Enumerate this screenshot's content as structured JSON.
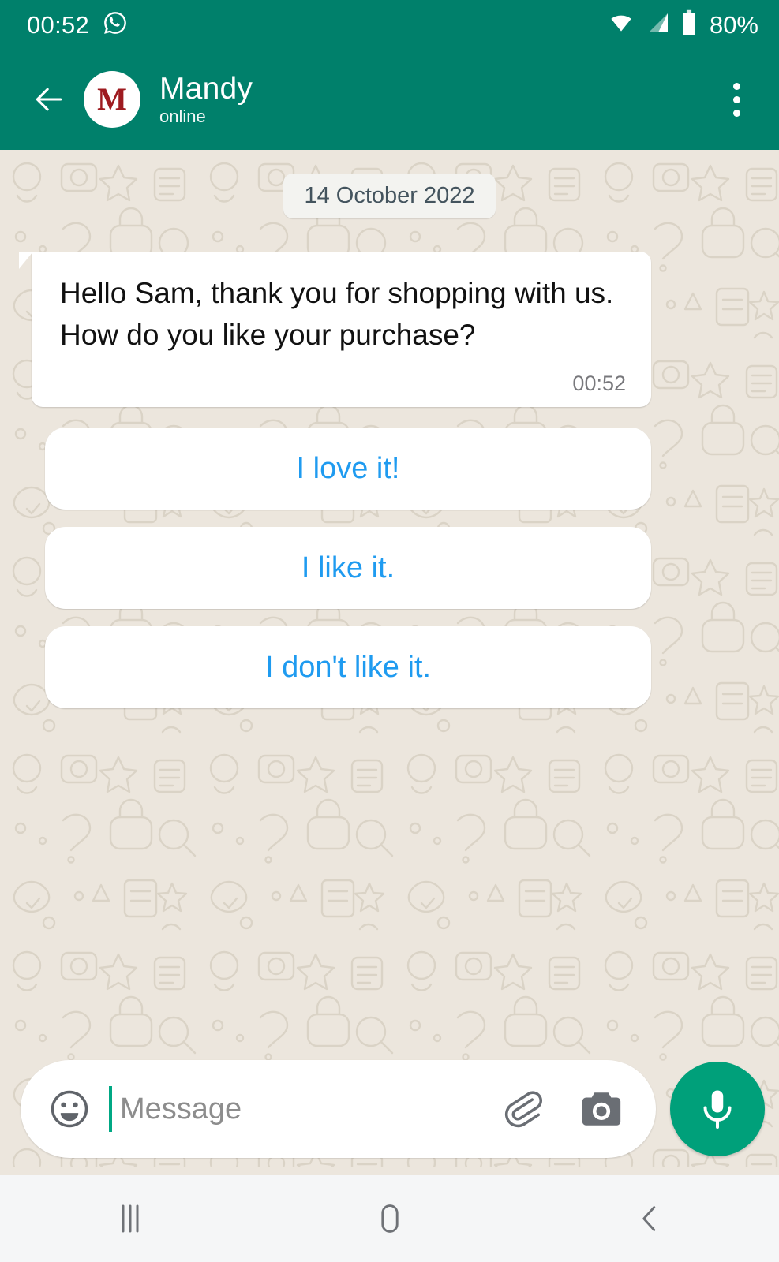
{
  "status_bar": {
    "time": "00:52",
    "notification_icon": "whatsapp-icon",
    "wifi_icon": "wifi-icon",
    "signal_icon": "cellular-signal-icon",
    "battery_icon": "battery-icon",
    "battery_percent": "80%"
  },
  "app_bar": {
    "back_icon": "back-arrow-icon",
    "avatar_letter": "M",
    "contact_name": "Mandy",
    "contact_status": "online",
    "overflow_icon": "more-vertical-icon"
  },
  "chat": {
    "date_divider": "14 October 2022",
    "messages": [
      {
        "text": "Hello Sam, thank you for shopping with us. How do you like your purchase?",
        "time": "00:52",
        "direction": "incoming"
      }
    ],
    "quick_replies": [
      {
        "label": "I love it!"
      },
      {
        "label": "I like it."
      },
      {
        "label": "I don't like it."
      }
    ]
  },
  "input_bar": {
    "emoji_icon": "emoji-smiley-icon",
    "placeholder": "Message",
    "value": "",
    "attach_icon": "paperclip-icon",
    "camera_icon": "camera-icon",
    "mic_icon": "microphone-icon"
  },
  "nav_bar": {
    "recents_icon": "recents-icon",
    "home_icon": "home-icon",
    "back_icon": "nav-back-icon"
  },
  "colors": {
    "header_green": "#00806b",
    "mic_green": "#00a07a",
    "chat_background": "#ece6dd",
    "bubble_white": "#ffffff",
    "quick_reply_blue": "#1f9bf0",
    "avatar_letter_red": "#9e1b20",
    "date_text": "#44545e",
    "timestamp_gray": "#78787c",
    "nav_bar_gray": "#f5f6f7"
  }
}
